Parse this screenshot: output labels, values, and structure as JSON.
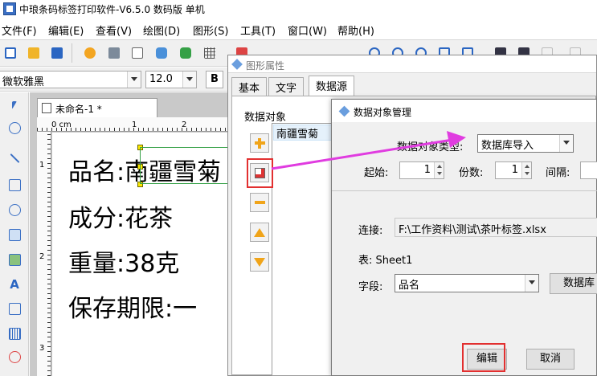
{
  "app": {
    "title": "中琅条码标签打印软件-V6.5.0 数码版 单机"
  },
  "menu": [
    "文件(F)",
    "编辑(E)",
    "查看(V)",
    "绘图(D)",
    "图形(S)",
    "工具(T)",
    "窗口(W)",
    "帮助(H)"
  ],
  "fontbar": {
    "font_name": "微软雅黑",
    "font_size": "12.0",
    "bold_label": "B"
  },
  "document": {
    "tab_title": "未命名-1 *",
    "ruler_unit": "0 cm",
    "ruler_h_ticks": [
      "1",
      "2"
    ],
    "ruler_v_ticks": [
      "1",
      "2",
      "3"
    ],
    "label_lines": [
      "品名:南疆雪菊",
      "成分:花茶",
      "重量:38克",
      "保存期限:一"
    ]
  },
  "prop_dialog": {
    "title": "图形属性",
    "tabs": [
      "基本",
      "文字",
      "数据源"
    ],
    "data_object_label": "数据对象",
    "data_object_item": "南疆雪菊"
  },
  "mgr_dialog": {
    "title": "数据对象管理",
    "type_label": "数据对象类型:",
    "type_value": "数据库导入",
    "start_label": "起始:",
    "start_value": "1",
    "copies_label": "份数:",
    "copies_value": "1",
    "interval_label": "间隔:",
    "connection_label": "连接:",
    "connection_value": "F:\\工作资料\\测试\\茶叶标签.xlsx",
    "table_text": "表: Sheet1",
    "field_label": "字段:",
    "field_value": "品名",
    "db_button": "数据库",
    "edit_button": "编辑",
    "cancel_button": "取消"
  },
  "colors": {
    "annotation_red": "#e23030",
    "arrow_magenta": "#e03ce0",
    "selection_handle": "#ffe800"
  }
}
